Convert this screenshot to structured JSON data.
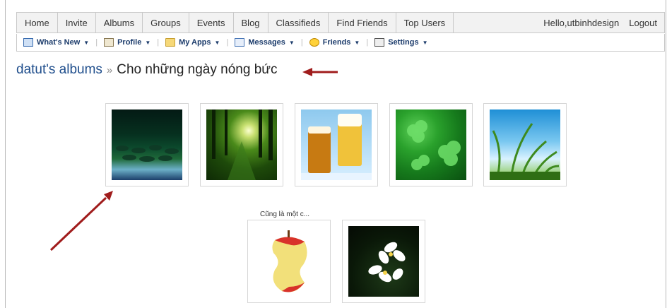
{
  "topnav": {
    "tabs": [
      "Home",
      "Invite",
      "Albums",
      "Groups",
      "Events",
      "Blog",
      "Classifieds",
      "Find Friends",
      "Top Users"
    ],
    "hello_prefix": "Hello, ",
    "username": "utbinhdesign",
    "logout": "Logout"
  },
  "subnav": {
    "whats_new": "What's New",
    "profile": "Profile",
    "my_apps": "My Apps",
    "messages": "Messages",
    "friends": "Friends",
    "settings": "Settings"
  },
  "heading": {
    "owner": "datut",
    "owner_suffix": "'s albums",
    "separator": "»",
    "album_title": "Cho những ngày nóng bức"
  },
  "photos": [
    {
      "caption": "",
      "icon": "lily-pond-photo"
    },
    {
      "caption": "",
      "icon": "forest-photo"
    },
    {
      "caption": "",
      "icon": "beer-glasses-photo"
    },
    {
      "caption": "",
      "icon": "clover-photo"
    },
    {
      "caption": "",
      "icon": "grass-sky-photo"
    },
    {
      "caption": "Cũng là một c...",
      "icon": "bitten-apple-photo"
    },
    {
      "caption": "",
      "icon": "frangipani-flower-photo"
    }
  ],
  "colors": {
    "link": "#1f4e8c",
    "annotation_arrow": "#a01c1c"
  }
}
